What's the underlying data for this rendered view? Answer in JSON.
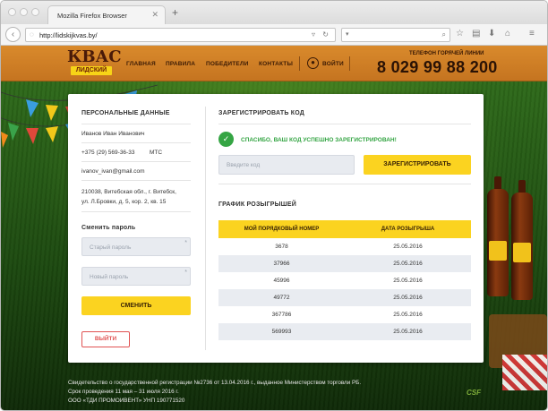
{
  "browser": {
    "tab_title": "Mozilla Firefox Browser",
    "url": "http://lidskijkvas.by/",
    "icons": [
      "back-icon",
      "forward-icon",
      "reload-icon",
      "bookmark-icon",
      "home-icon",
      "menu-icon"
    ]
  },
  "header": {
    "logo_main": "КВАС",
    "logo_sub": "ЛИДСКИЙ",
    "menu": [
      "ГЛАВНАЯ",
      "ПРАВИЛА",
      "ПОБЕДИТЕЛИ",
      "КОНТАКТЫ"
    ],
    "login": "ВОЙТИ",
    "hotline_label": "ТЕЛЕФОН ГОРЯЧЕЙ ЛИНИИ",
    "hotline_phone": "8 029 99 88 200"
  },
  "personal": {
    "title": "ПЕРСОНАЛЬНЫЕ ДАННЫЕ",
    "name": "Иванов Иван Иванович",
    "phone": "+375 (29) 569-36-33",
    "operator": "МТС",
    "email": "ivanov_ivan@gmail.com",
    "address_line1": "210038, Витебская обл., г. Витебск,",
    "address_line2": "ул. Л.Бровки, д. 5, кор. 2, кв. 15"
  },
  "password": {
    "title": "Сменить пароль",
    "old_placeholder": "Старый пароль",
    "new_placeholder": "Новый пароль",
    "submit": "СМЕНИТЬ",
    "logout": "ВЫЙТИ"
  },
  "register": {
    "title": "ЗАРЕГИСТРИРОВАТЬ КОД",
    "success": "СПАСИБО,  ВАШ КОД УСПЕШНО ЗАРЕГИСТРИРОВАН!",
    "code_placeholder": "Введите код",
    "button": "ЗАРЕГИСТРИРОВАТЬ"
  },
  "schedule": {
    "title": "ГРАФИК РОЗЫГРЫШЕЙ",
    "col1": "МОЙ ПОРЯДКОВЫЙ НОМЕР",
    "col2": "ДАТА РОЗЫГРЫША",
    "rows": [
      {
        "num": "3678",
        "date": "25.05.2016"
      },
      {
        "num": "37966",
        "date": "25.05.2016"
      },
      {
        "num": "45996",
        "date": "25.05.2016"
      },
      {
        "num": "49772",
        "date": "25.05.2016"
      },
      {
        "num": "367786",
        "date": "25.05.2016"
      },
      {
        "num": "569993",
        "date": "25.05.2016"
      }
    ]
  },
  "footer": {
    "line1": "Свидетельство о государственной регистрации №2736 от 13.04.2016 г., выданное Министерством торговли РБ.",
    "line2": "Срок проведения 11 мая – 31 июля 2016 г.",
    "line3": "ООО «ТДИ ПРОМОИВЕНТ» УНП 190771520",
    "brand": "CSF"
  }
}
